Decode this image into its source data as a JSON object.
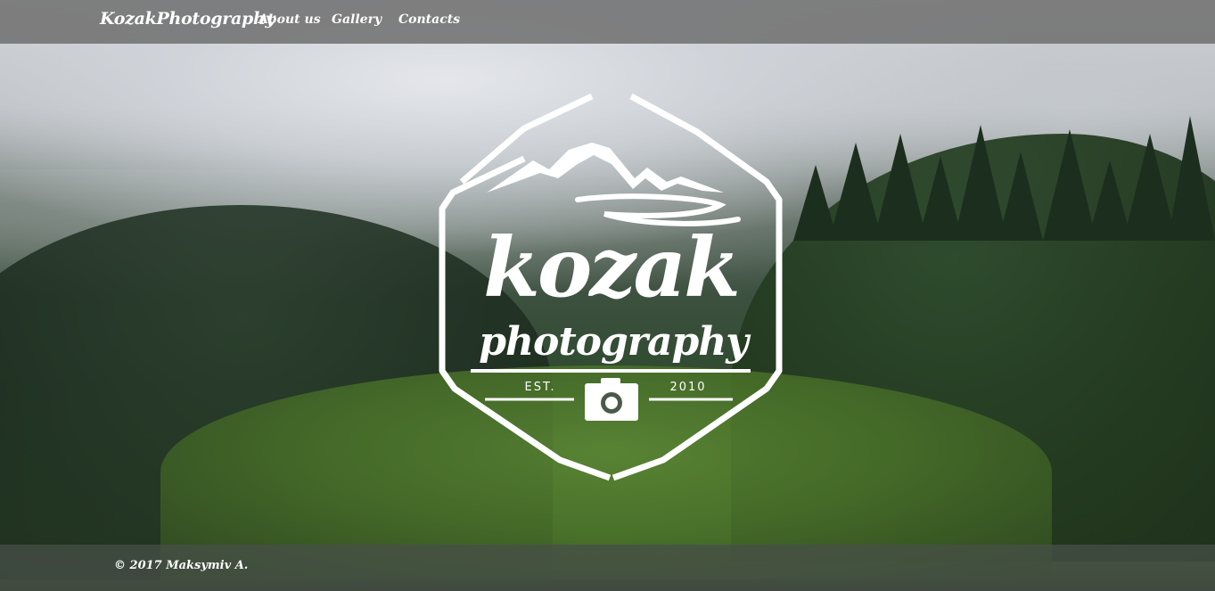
{
  "nav": {
    "brand": "KozakPhotography",
    "links": [
      {
        "label": "About us"
      },
      {
        "label": "Gallery"
      },
      {
        "label": "Contacts"
      }
    ]
  },
  "logo": {
    "word_main": "kozak",
    "word_sub": "photography",
    "est_label": "EST.",
    "year": "2010",
    "icons": [
      "mountains-icon",
      "camera-icon"
    ],
    "color": "#ffffff"
  },
  "footer": {
    "copyright": "© 2017 Maksymiv A."
  },
  "colors": {
    "topbar": "#6e6e6e",
    "footer": "#465046",
    "text": "#ffffff"
  }
}
